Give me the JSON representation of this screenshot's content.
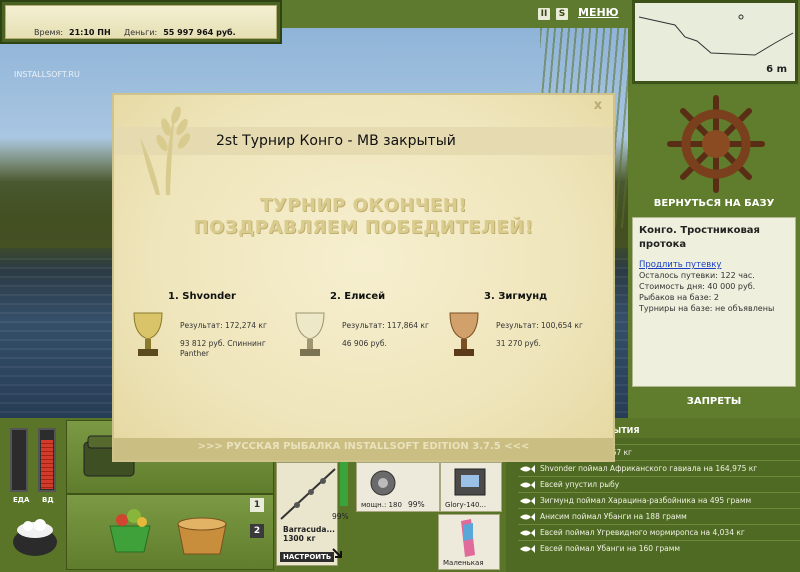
{
  "status": {
    "time_label": "Время:",
    "time_value": "21:10 ПН",
    "money_label": "Деньги:",
    "money_value": "55 997 964 руб."
  },
  "header": {
    "icon_pause": "II",
    "icon_s": "S",
    "menu": "МЕНЮ"
  },
  "depth": {
    "label": "6 m"
  },
  "site_tag": "INSTALLSOFT.RU",
  "right_panel": {
    "home_button": "ВЕРНУТЬСЯ НА БАЗУ",
    "location": "Конго. Тростниковая протока",
    "extend_link": "Продлить путевку",
    "rows": [
      "Осталось путевки: 122 час.",
      "Стоимость дня: 40 000 руб.",
      "Рыбаков на базе: 2",
      "Турниры на базе: не объявлены"
    ],
    "bans": "ЗАПРЕТЫ"
  },
  "modal": {
    "title": "2st Турнир Конго - МВ закрытый",
    "headline_1": "ТУРНИР ОКОНЧЕН!",
    "headline_2": "ПОЗДРАВЛЯЕМ ПОБЕДИТЕЛЕЙ!",
    "close": "x",
    "winners": [
      {
        "place": "1. Shvonder",
        "result": "Результат: 172,274 кг",
        "prize": "93 812 руб. Спиннинг Panther",
        "cup": "gold"
      },
      {
        "place": "2. Елисей",
        "result": "Результат: 117,864 кг",
        "prize": "46 906 руб.",
        "cup": "silver"
      },
      {
        "place": "3. Зигмунд",
        "result": "Результат: 100,654 кг",
        "prize": "31 270 руб.",
        "cup": "bronze"
      }
    ],
    "version": ">>> РУССКАЯ РЫБАЛКА INSTALLSOFT EDITION 3.7.5 <<<"
  },
  "bottom": {
    "food_label": "ЕДА",
    "water_label": "ВД",
    "food_level": 0.0,
    "water_level": 0.85,
    "page_1": "1",
    "page_2": "2",
    "rod_name": "Barracuda...",
    "rod_weight": "1300 кг",
    "tune_button": "НАСТРОИТЬ",
    "rod_percent": "99%",
    "reel_label": "мощн.: 180",
    "reel_percent": "99%",
    "lure_label": "Glory-140...",
    "lure2_label": "Маленькая"
  },
  "log": {
    "title": "ОБЫТИЯ",
    "rows": [
      "ома вунду на 11,267 кг",
      "Shvonder поймал Африканского гавиала на 164,975 кг",
      "Евсей упустил рыбу",
      "Зигмунд поймал Харацина-разбойника на 495 грамм",
      "Анисим поймал Убанги на 188 грамм",
      "Евсей поймал Угревидного мормиропса на 4,034 кг",
      "Евсей поймал Убанги на 160 грамм"
    ]
  }
}
